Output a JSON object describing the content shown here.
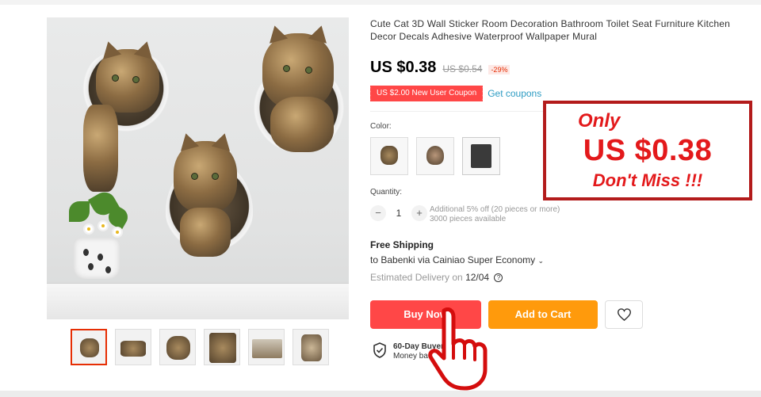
{
  "product": {
    "title": "Cute Cat 3D Wall Sticker Room Decoration Bathroom Toilet Seat Furniture Kitchen Decor Decals Adhesive Waterproof Wallpaper Mural",
    "price": "US $0.38",
    "original_price": "US $0.54",
    "discount": "-29%",
    "coupon": "US $2.00 New User Coupon",
    "get_coupons": "Get coupons"
  },
  "options": {
    "color_label": "Color:",
    "swatch_icons": [
      "cat-sticker-variant-1",
      "cat-sticker-toilet-variant",
      "cat-sticker-frame-variant"
    ]
  },
  "quantity": {
    "label": "Quantity:",
    "minus": "−",
    "value": "1",
    "plus": "+",
    "note_line1": "Additional 5% off (20 pieces or more)",
    "note_line2": "3000 pieces available"
  },
  "shipping": {
    "title": "Free Shipping",
    "destination": "to Babenki via Cainiao Super Economy",
    "estimate_label": "Estimated Delivery on",
    "estimate_date": "12/04",
    "help_icon": "?"
  },
  "actions": {
    "buy_now": "Buy Now",
    "add_to_cart": "Add to Cart"
  },
  "protection": {
    "line1": "60-Day Buyer Protection",
    "line2": "Money back guarantee"
  },
  "promo": {
    "line1": "Only",
    "line2": "US $0.38",
    "line3": "Don't Miss !!!"
  },
  "colors": {
    "accent_red": "#ff4747",
    "orange": "#ff9a0c",
    "promo_red": "#e3191b",
    "link_blue": "#2e9cc3"
  }
}
